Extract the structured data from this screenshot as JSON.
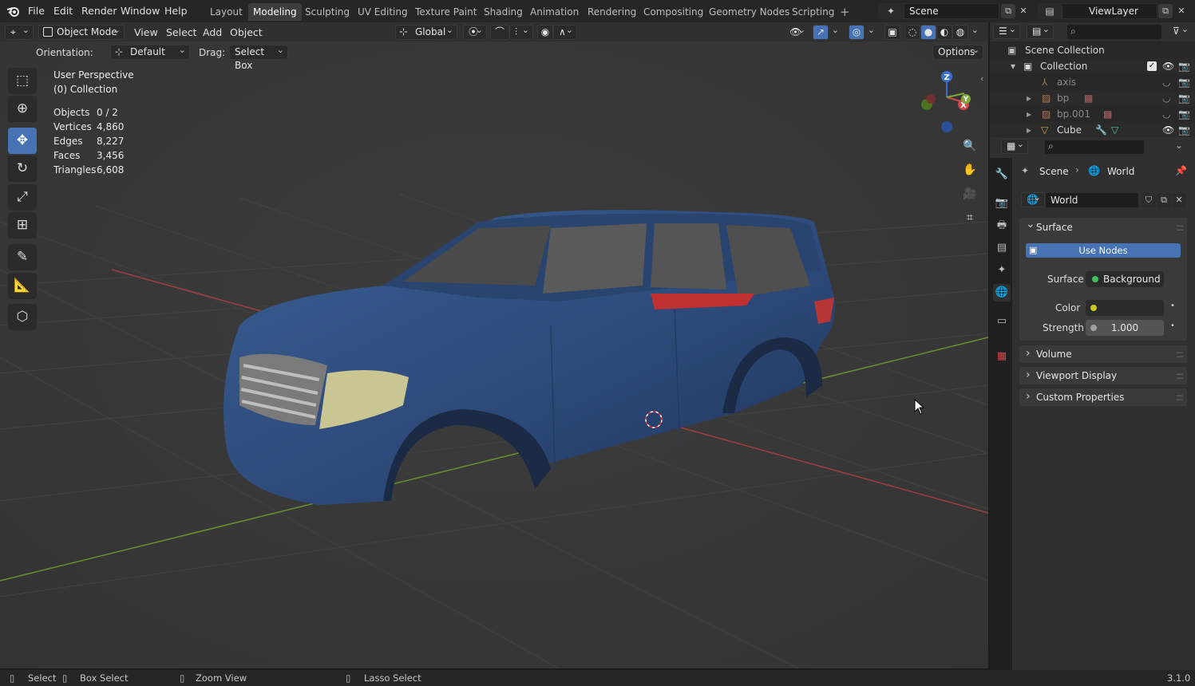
{
  "topbar": {
    "menus": [
      "File",
      "Edit",
      "Render",
      "Window",
      "Help"
    ],
    "workspaces": [
      "Layout",
      "Modeling",
      "Sculpting",
      "UV Editing",
      "Texture Paint",
      "Shading",
      "Animation",
      "Rendering",
      "Compositing",
      "Geometry Nodes",
      "Scripting"
    ],
    "active_workspace": "Modeling",
    "add_tab": "+",
    "scene": "Scene",
    "view_layer": "ViewLayer"
  },
  "viewport": {
    "mode": "Object Mode",
    "menus": [
      "View",
      "Select",
      "Add",
      "Object"
    ],
    "transform_orientation": "Global",
    "options": "Options",
    "tool_settings": {
      "orientation_label": "Orientation:",
      "orientation_value": "Default",
      "drag_label": "Drag:",
      "drag_value": "Select Box"
    },
    "overlay_text": {
      "perspective": "User Perspective",
      "collection": "(0) Collection"
    },
    "stats": [
      {
        "label": "Objects",
        "value": "0 / 2"
      },
      {
        "label": "Vertices",
        "value": "4,860"
      },
      {
        "label": "Edges",
        "value": "8,227"
      },
      {
        "label": "Faces",
        "value": "3,456"
      },
      {
        "label": "Triangles",
        "value": "6,608"
      }
    ],
    "gizmo": {
      "z": "Z",
      "x": "X",
      "y": "Y"
    },
    "colors": {
      "x_axis": "#d04848",
      "y_axis": "#7ea83a",
      "z_axis": "#3b6fd6",
      "car_body": "#2f4a7a",
      "background": "#3a3a3a"
    },
    "tools": [
      "select-box-icon",
      "cursor-icon",
      "move-icon",
      "rotate-icon",
      "scale-icon",
      "transform-icon",
      "annotate-icon",
      "measure-icon",
      "add-cube-icon"
    ],
    "active_tool": "move-icon"
  },
  "outliner": {
    "search_placeholder": "",
    "items": [
      {
        "name": "Scene Collection",
        "indent": 0,
        "icon": "scene-collection-icon"
      },
      {
        "name": "Collection",
        "indent": 1,
        "icon": "collection-icon",
        "checked": true
      },
      {
        "name": "axis",
        "indent": 2,
        "icon": "empty-icon"
      },
      {
        "name": "bp",
        "indent": 2,
        "icon": "image-icon"
      },
      {
        "name": "bp.001",
        "indent": 2,
        "icon": "image-icon"
      },
      {
        "name": "Cube",
        "indent": 2,
        "icon": "mesh-icon"
      }
    ]
  },
  "properties": {
    "breadcrumb": [
      "Scene",
      "World"
    ],
    "world_name": "World",
    "panels": {
      "surface": "Surface",
      "use_nodes": "Use Nodes",
      "surface_label": "Surface",
      "surface_value": "Background",
      "color_label": "Color",
      "strength_label": "Strength",
      "strength_value": "1.000",
      "volume": "Volume",
      "viewport_display": "Viewport Display",
      "custom_properties": "Custom Properties"
    }
  },
  "statusbar": {
    "select": "Select",
    "box_select": "Box Select",
    "zoom_view": "Zoom View",
    "lasso_select": "Lasso Select",
    "version": "3.1.0"
  }
}
